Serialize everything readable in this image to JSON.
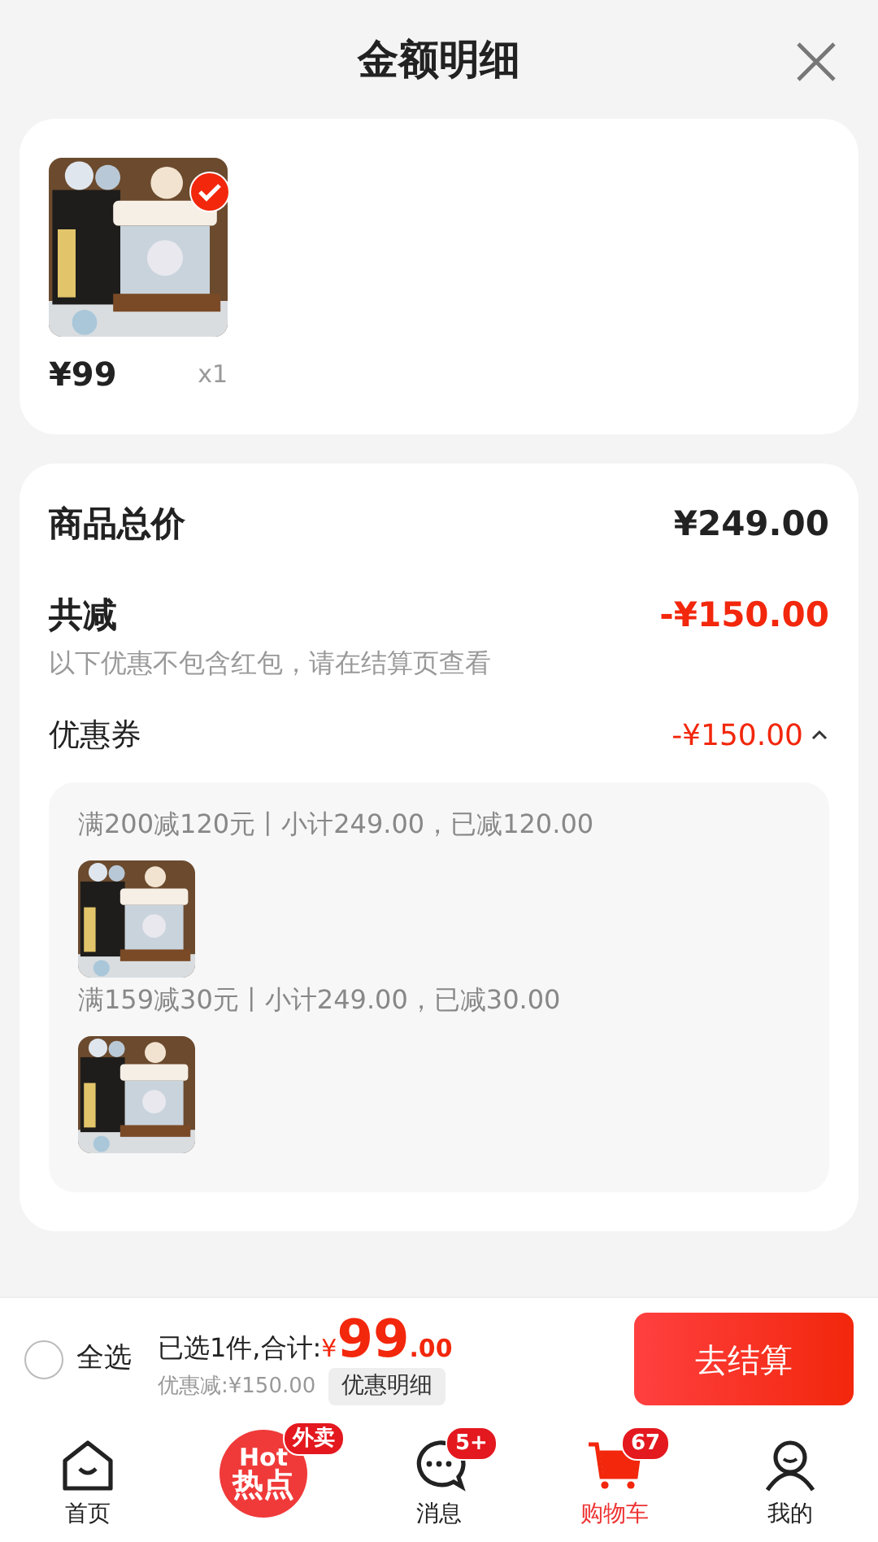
{
  "header": {
    "title": "金额明细"
  },
  "selected_items": [
    {
      "price": "¥99",
      "quantity": "x1",
      "checked": true
    }
  ],
  "summary": {
    "total": {
      "label": "商品总价",
      "value": "¥249.00"
    },
    "discount": {
      "label": "共减",
      "value": "-¥150.00",
      "note": "以下优惠不包含红包，请在结算页查看"
    },
    "coupon": {
      "label": "优惠券",
      "value": "-¥150.00",
      "expanded": true
    },
    "coupon_details": [
      {
        "text": "满200减120元丨小计249.00，已减120.00"
      },
      {
        "text": "满159减30元丨小计249.00，已减30.00"
      }
    ]
  },
  "checkout_bar": {
    "select_all": {
      "label": "全选",
      "checked": false
    },
    "selected_text": "已选1件,合计:",
    "currency": "¥",
    "amount_integer": "99",
    "amount_decimal": ".00",
    "discount_text": "优惠减:¥150.00",
    "detail_button": "优惠明细",
    "checkout_button": "去结算"
  },
  "tab_bar": [
    {
      "kind": "home",
      "label": "首页",
      "selected": false
    },
    {
      "kind": "hot",
      "logo_lines": [
        "Hot",
        "热点"
      ],
      "badge": "外卖",
      "selected": false
    },
    {
      "kind": "message",
      "label": "消息",
      "badge": "5+",
      "selected": false
    },
    {
      "kind": "cart",
      "label": "购物车",
      "badge": "67",
      "selected": true
    },
    {
      "kind": "profile",
      "label": "我的",
      "selected": false
    }
  ]
}
